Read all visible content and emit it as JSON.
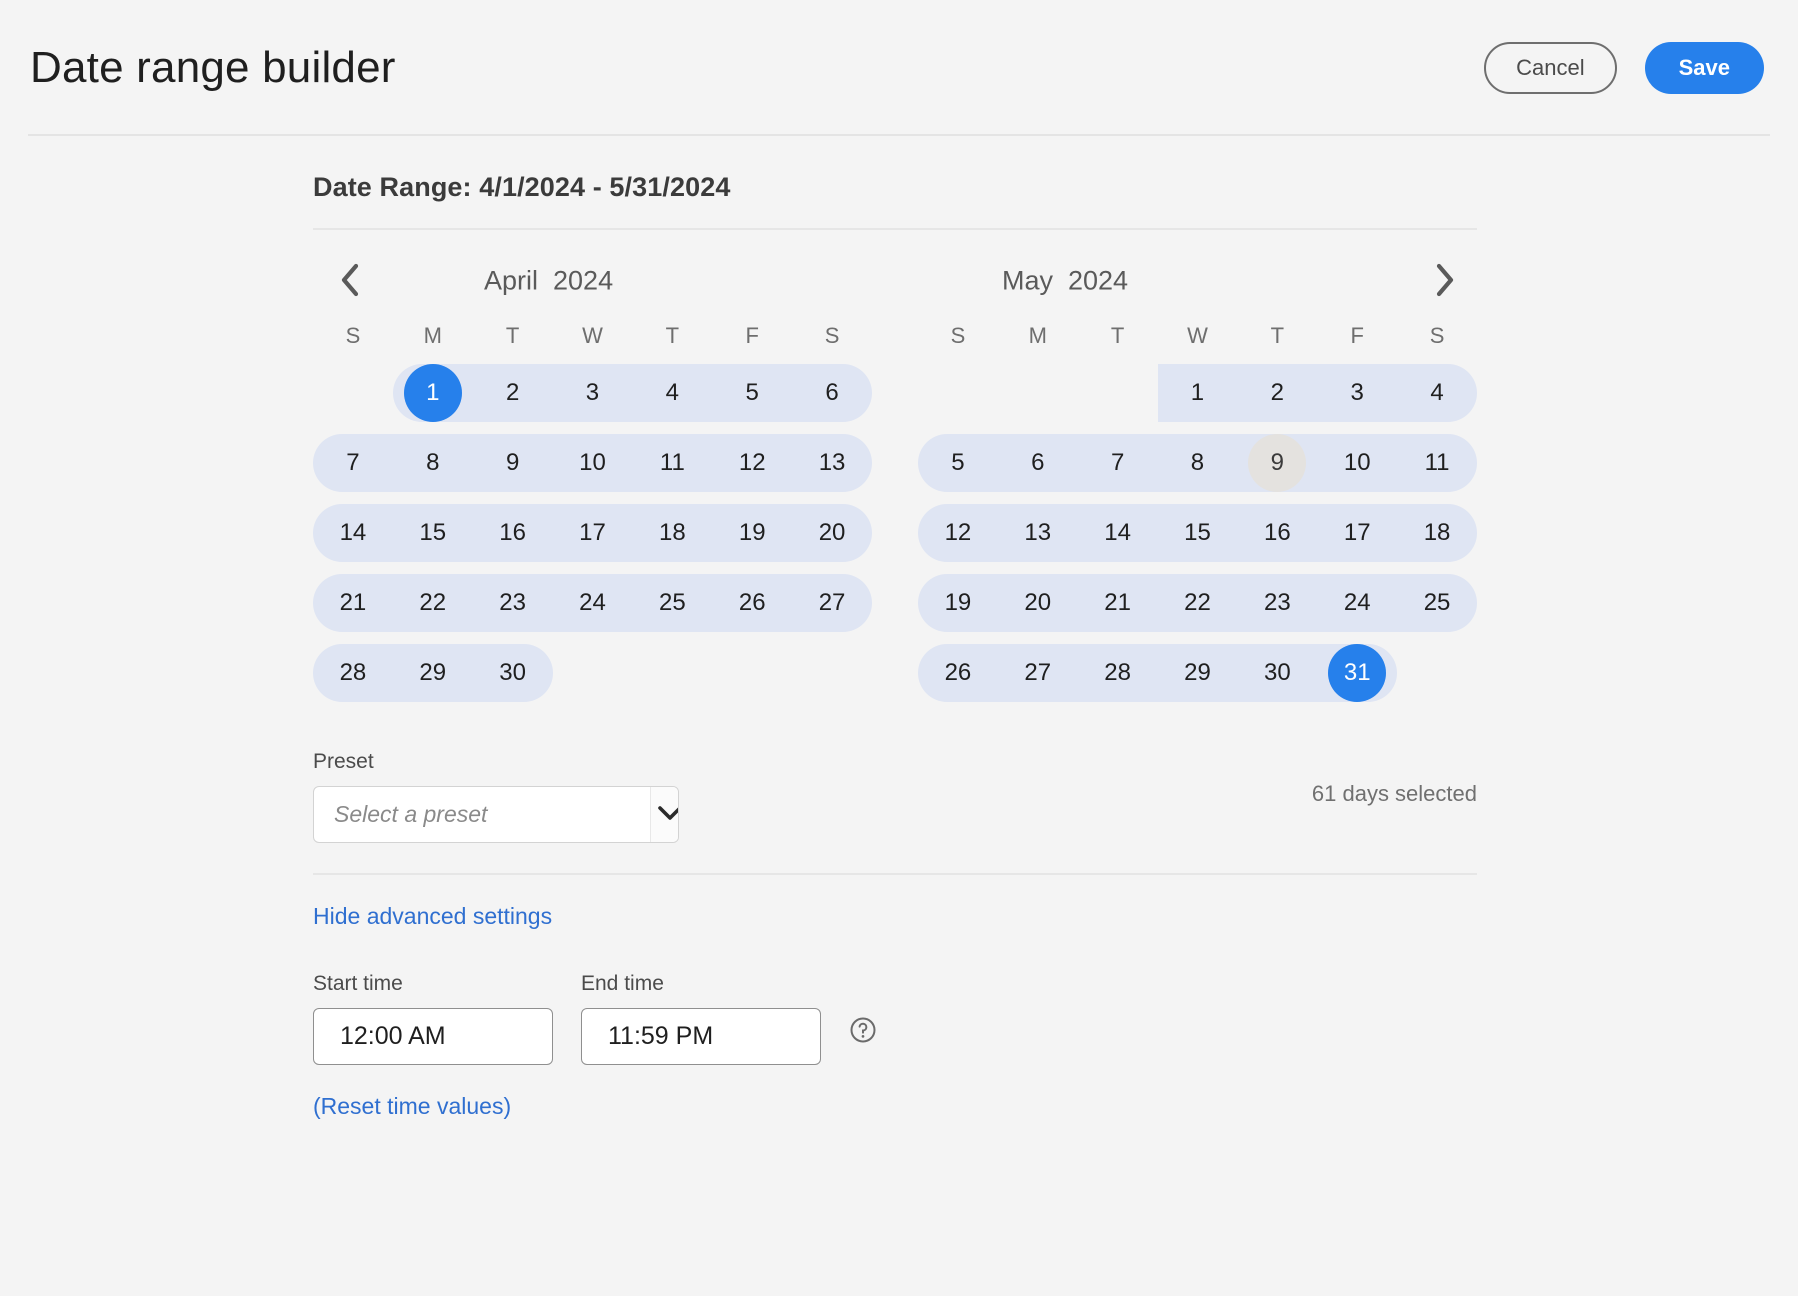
{
  "header": {
    "title": "Date range builder",
    "cancel_label": "Cancel",
    "save_label": "Save"
  },
  "range_title": "Date Range: 4/1/2024 - 5/31/2024",
  "calendar": {
    "prev_icon": "chevron-left-icon",
    "next_icon": "chevron-right-icon",
    "weekdays": [
      "S",
      "M",
      "T",
      "W",
      "T",
      "F",
      "S"
    ],
    "months": [
      {
        "name": "April",
        "year": "2024",
        "label": "April  2024",
        "weeks": [
          [
            null,
            "1",
            "2",
            "3",
            "4",
            "5",
            "6"
          ],
          [
            "7",
            "8",
            "9",
            "10",
            "11",
            "12",
            "13"
          ],
          [
            "14",
            "15",
            "16",
            "17",
            "18",
            "19",
            "20"
          ],
          [
            "21",
            "22",
            "23",
            "24",
            "25",
            "26",
            "27"
          ],
          [
            "28",
            "29",
            "30",
            null,
            null,
            null,
            null
          ]
        ],
        "bands": [
          {
            "start": 1,
            "end": 6,
            "round_left": true,
            "round_right": true
          },
          {
            "start": 0,
            "end": 6,
            "round_left": true,
            "round_right": true
          },
          {
            "start": 0,
            "end": 6,
            "round_left": true,
            "round_right": true
          },
          {
            "start": 0,
            "end": 6,
            "round_left": true,
            "round_right": true
          },
          {
            "start": 0,
            "end": 2,
            "round_left": true,
            "round_right": true
          }
        ],
        "selected": [
          "1"
        ],
        "today": []
      },
      {
        "name": "May",
        "year": "2024",
        "label": "May  2024",
        "weeks": [
          [
            null,
            null,
            null,
            "1",
            "2",
            "3",
            "4"
          ],
          [
            "5",
            "6",
            "7",
            "8",
            "9",
            "10",
            "11"
          ],
          [
            "12",
            "13",
            "14",
            "15",
            "16",
            "17",
            "18"
          ],
          [
            "19",
            "20",
            "21",
            "22",
            "23",
            "24",
            "25"
          ],
          [
            "26",
            "27",
            "28",
            "29",
            "30",
            "31",
            null
          ]
        ],
        "bands": [
          {
            "start": 3,
            "end": 6,
            "round_left": false,
            "round_right": true
          },
          {
            "start": 0,
            "end": 6,
            "round_left": true,
            "round_right": true
          },
          {
            "start": 0,
            "end": 6,
            "round_left": true,
            "round_right": true
          },
          {
            "start": 0,
            "end": 6,
            "round_left": true,
            "round_right": true
          },
          {
            "start": 0,
            "end": 5,
            "round_left": true,
            "round_right": true
          }
        ],
        "selected": [
          "31"
        ],
        "today": [
          "9"
        ]
      }
    ]
  },
  "preset": {
    "label": "Preset",
    "placeholder": "Select a preset",
    "value": "",
    "toggle_icon": "chevron-down-icon"
  },
  "days_selected": "61 days selected",
  "advanced": {
    "toggle_label": "Hide advanced settings",
    "start_time_label": "Start time",
    "start_time_value": "12:00 AM",
    "end_time_label": "End time",
    "end_time_value": "11:59 PM",
    "help_icon": "help-circle-icon",
    "reset_label": "(Reset time values)"
  },
  "colors": {
    "accent": "#2680eb",
    "link": "#2f6fd0",
    "range_highlight": "#dfe5f3",
    "today_highlight": "#e4e2df",
    "page_background": "#f4f4f4"
  }
}
